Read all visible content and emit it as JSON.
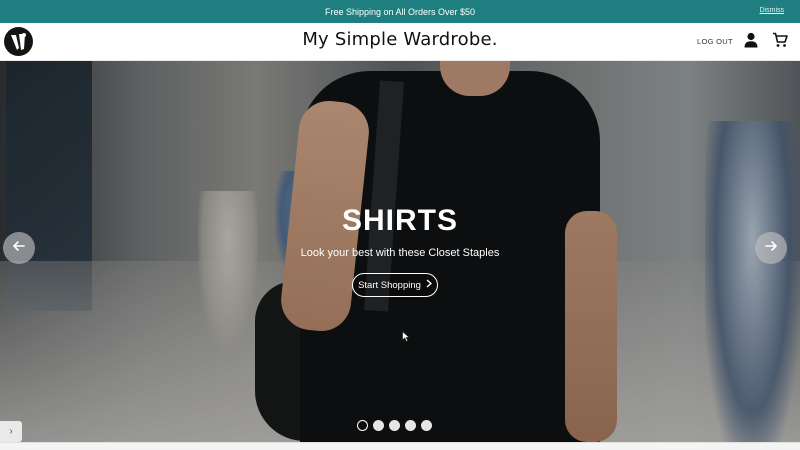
{
  "announcement": {
    "text": "Free Shipping on All Orders Over $50",
    "dismiss_label": "Dismiss",
    "bg_color": "#1f7f80"
  },
  "header": {
    "logo_icon": "wardrobe-logo-icon",
    "brand": "My Simple Wardrobe.",
    "logout_label": "LOG OUT",
    "account_icon": "user-icon",
    "cart_icon": "cart-icon"
  },
  "hero": {
    "title": "SHIRTS",
    "subtitle": "Look your best with these Closet Staples",
    "cta_label": "Start Shopping",
    "cta_icon": "chevron-right-icon",
    "prev_icon": "arrow-left-icon",
    "next_icon": "arrow-right-icon",
    "slide_count": 5,
    "active_slide": 1
  },
  "side_tab": {
    "label": "›"
  }
}
